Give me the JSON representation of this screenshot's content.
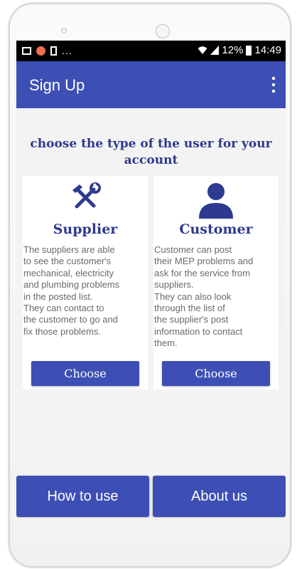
{
  "statusbar": {
    "dots": "...",
    "battery_percent": "12%",
    "time": "14:49"
  },
  "appbar": {
    "title": "Sign Up",
    "menu_icon": "more-vert-icon"
  },
  "heading": "choose the type of the user for your account",
  "cards": [
    {
      "icon": "tools-icon",
      "title": "Supplier",
      "description": "    The suppliers are able\nto see the customer's\nmechanical, electricity\nand plumbing problems\nin the posted list.\n    They can contact to\nthe customer to go and\nfix those problems.",
      "button_label": "Choose"
    },
    {
      "icon": "person-icon",
      "title": "Customer",
      "description": "    Customer can post\ntheir MEP problems and\nask for the service from\nsuppliers.\n    They can also look\nthrough the list of\nthe supplier's post\ninformation to contact\nthem.",
      "button_label": "Choose"
    }
  ],
  "bottom": {
    "how_to_use": "How to use",
    "about_us": "About us"
  },
  "colors": {
    "primary": "#3d4fb4",
    "heading": "#2d3a8f"
  }
}
